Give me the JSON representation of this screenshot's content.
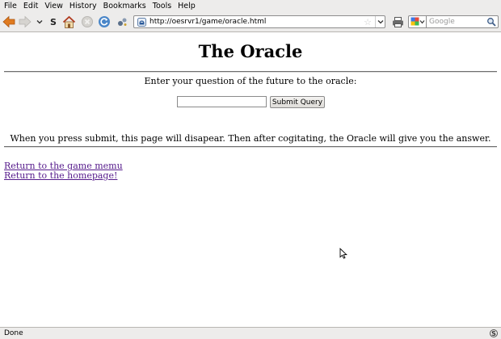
{
  "menu": {
    "file": "File",
    "edit": "Edit",
    "view": "View",
    "history": "History",
    "bookmarks": "Bookmarks",
    "tools": "Tools",
    "help": "Help"
  },
  "toolbar": {
    "url": "http://oesrvr1/game/oracle.html",
    "search_placeholder": "Google",
    "icons": [
      "back-arrow-icon",
      "forward-arrow-icon",
      "history-dropdown-icon",
      "s-icon",
      "home-icon",
      "stop-icon",
      "reload-icon",
      "extension-icon",
      "print-icon",
      "google-engine-icon",
      "magnifier-icon"
    ]
  },
  "page": {
    "title": "The Oracle",
    "prompt": "Enter your question of the future to the oracle:",
    "question_value": "",
    "submit_label": "Submit Query",
    "notice": "When you press submit, this page will disapear. Then after cogitating, the Oracle will give you the answer.",
    "links": {
      "game_menu": "Return to the game memu",
      "homepage": "Return to the homepage!"
    }
  },
  "status": {
    "text": "Done"
  },
  "colors": {
    "chrome": "#edeceb",
    "visited_link": "#551a8b"
  }
}
